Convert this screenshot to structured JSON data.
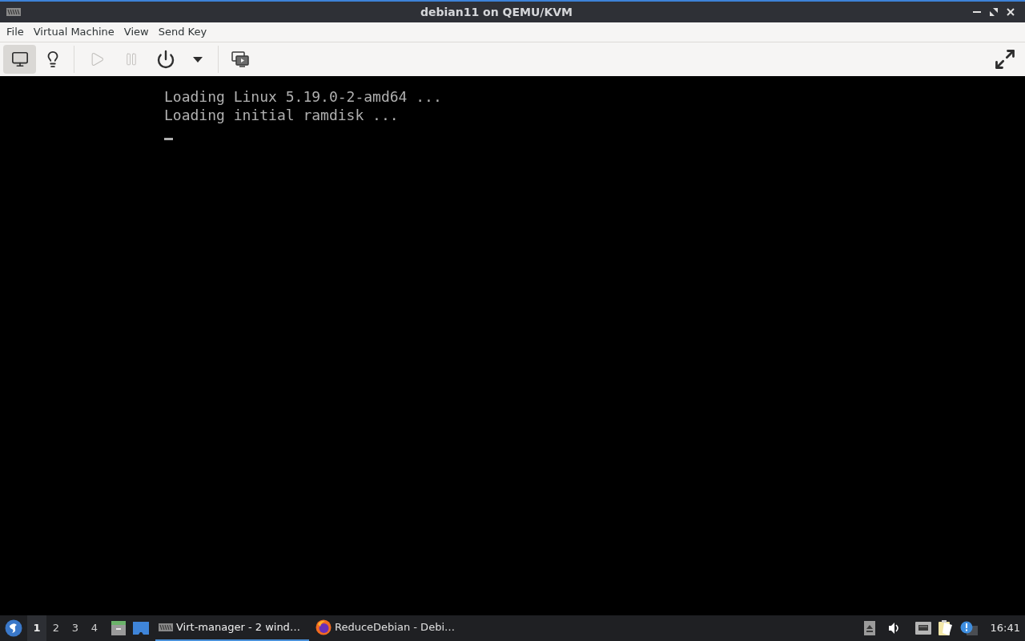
{
  "window": {
    "title": "debian11 on QEMU/KVM"
  },
  "menu": [
    "File",
    "Virtual Machine",
    "View",
    "Send Key"
  ],
  "view_buttons": [
    {
      "kind": "console",
      "selected": true
    },
    {
      "kind": "details",
      "selected": false
    }
  ],
  "run_buttons": [
    {
      "kind": "run",
      "disabled": true
    },
    {
      "kind": "pause",
      "disabled": true
    },
    {
      "kind": "shutdown",
      "disabled": false
    }
  ],
  "console": {
    "lines": [
      "Loading Linux 5.19.0-2-amd64 ...",
      "Loading initial ramdisk ..."
    ]
  },
  "taskbar": {
    "workspaces": [
      {
        "label": "1",
        "selected": true
      },
      {
        "label": "2",
        "selected": false
      },
      {
        "label": "3",
        "selected": false
      },
      {
        "label": "4",
        "selected": false
      }
    ],
    "tasks": [
      {
        "kind": "virt-manager",
        "label": "Virt-manager - 2 wind…",
        "selected": true
      },
      {
        "kind": "browser",
        "label": "ReduceDebian - Debi…",
        "selected": false
      }
    ],
    "clock": "16:41"
  }
}
